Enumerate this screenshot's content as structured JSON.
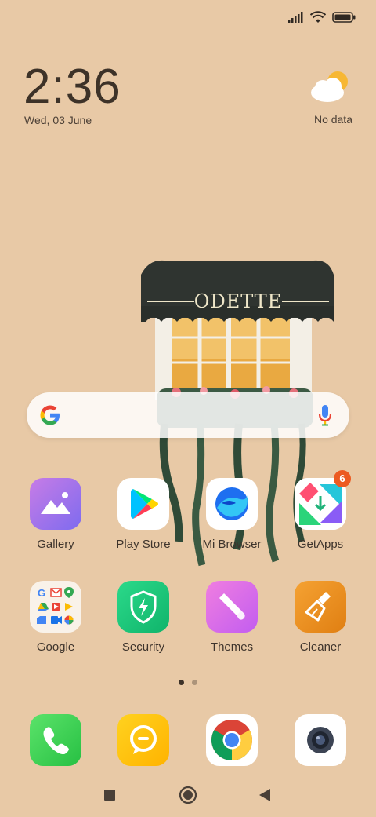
{
  "status_bar": {
    "signal_icon": "signal-icon",
    "wifi_icon": "wifi-icon",
    "battery_icon": "battery-icon"
  },
  "clock": {
    "time": "2:36",
    "date": "Wed, 03 June"
  },
  "weather": {
    "icon": "partly-cloudy-icon",
    "text": "No data"
  },
  "wallpaper": {
    "sign_text": "ODETTE"
  },
  "search": {
    "icon": "google-logo-icon",
    "mic_icon": "mic-icon"
  },
  "apps_row1": [
    {
      "label": "Gallery",
      "icon": "gallery-icon"
    },
    {
      "label": "Play Store",
      "icon": "play-store-icon"
    },
    {
      "label": "Mi Browser",
      "icon": "mi-browser-icon"
    },
    {
      "label": "GetApps",
      "icon": "getapps-icon",
      "badge": "6"
    }
  ],
  "apps_row2": [
    {
      "label": "Google",
      "icon": "google-folder-icon"
    },
    {
      "label": "Security",
      "icon": "security-icon"
    },
    {
      "label": "Themes",
      "icon": "themes-icon"
    },
    {
      "label": "Cleaner",
      "icon": "cleaner-icon"
    }
  ],
  "page_indicator": {
    "pages": 2,
    "current": 1
  },
  "dock": [
    "phone-icon",
    "messaging-icon",
    "chrome-icon",
    "camera-icon"
  ],
  "navigation": [
    "recents-button",
    "home-button",
    "back-button"
  ],
  "colors": {
    "background": "#e8c9a6",
    "badge": "#ec5a21"
  }
}
